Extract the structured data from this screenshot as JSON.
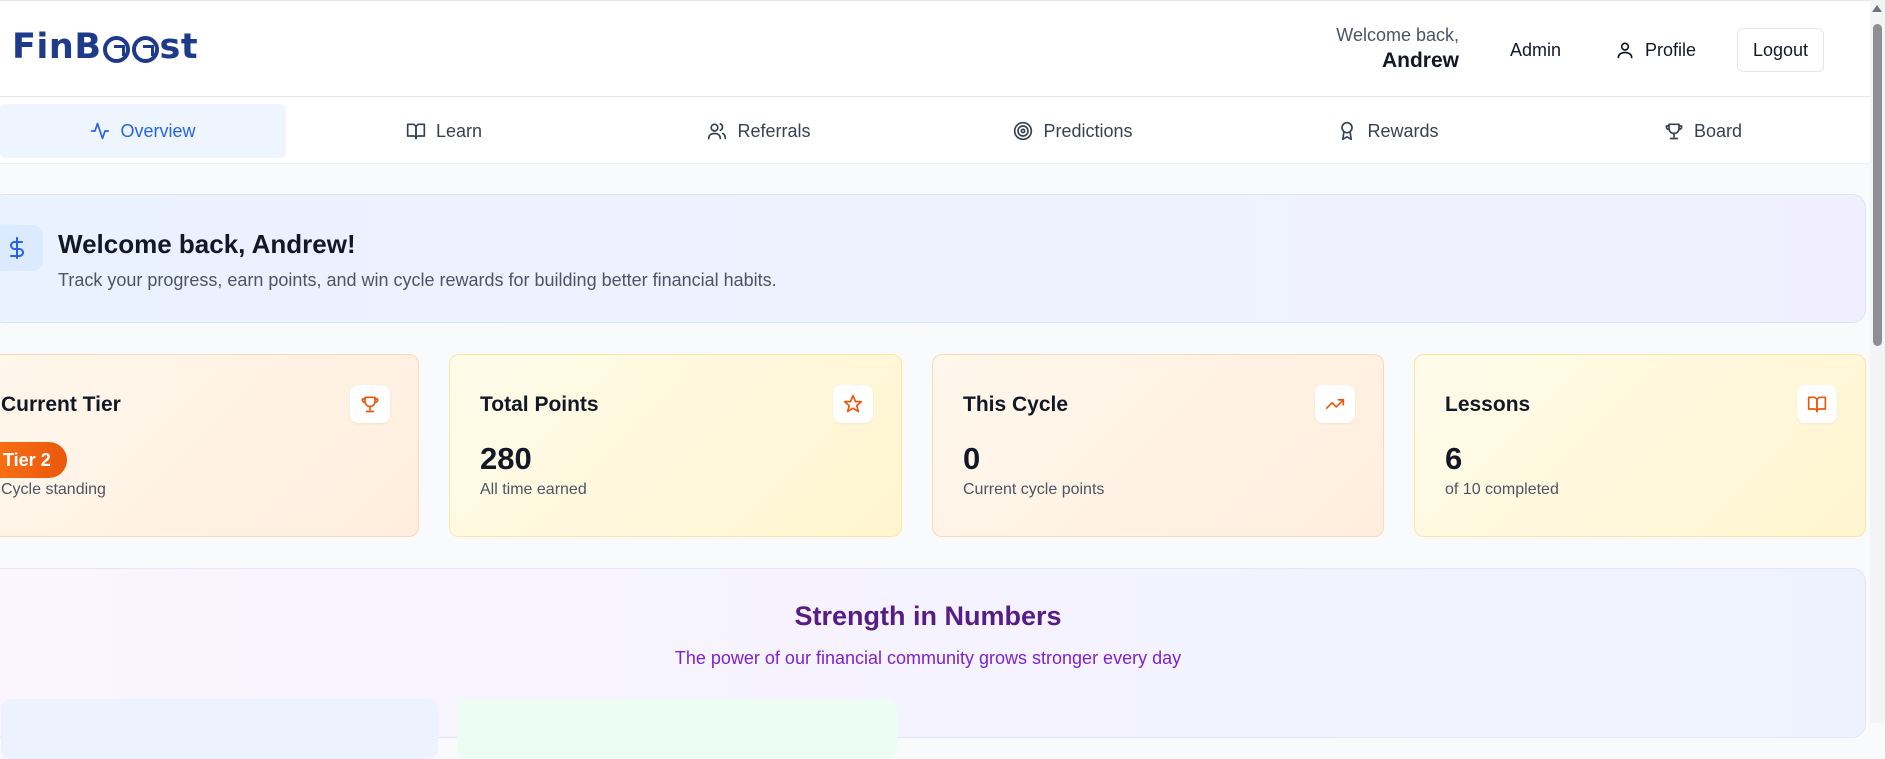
{
  "header": {
    "logo": "FinBoost",
    "welcome_prefix": "Welcome back,",
    "user_name": "Andrew",
    "admin_label": "Admin",
    "profile_label": "Profile",
    "logout_label": "Logout"
  },
  "tabs": [
    {
      "label": "Overview",
      "icon": "activity-icon",
      "active": true
    },
    {
      "label": "Learn",
      "icon": "book-open-icon",
      "active": false
    },
    {
      "label": "Referrals",
      "icon": "users-icon",
      "active": false
    },
    {
      "label": "Predictions",
      "icon": "target-icon",
      "active": false
    },
    {
      "label": "Rewards",
      "icon": "award-icon",
      "active": false
    },
    {
      "label": "Board",
      "icon": "trophy-icon",
      "active": false
    }
  ],
  "banner": {
    "icon": "dollar-icon",
    "title": "Welcome back, Andrew!",
    "subtitle": "Track your progress, earn points, and win cycle rewards for building better financial habits."
  },
  "stats": [
    {
      "title": "Current Tier",
      "badge": "Tier 2",
      "sub": "Cycle standing",
      "icon": "trophy-icon"
    },
    {
      "title": "Total Points",
      "value": "280",
      "sub": "All time earned",
      "icon": "star-icon"
    },
    {
      "title": "This Cycle",
      "value": "0",
      "sub": "Current cycle points",
      "icon": "trending-up-icon"
    },
    {
      "title": "Lessons",
      "value": "6",
      "sub": "of 10 completed",
      "icon": "book-open-icon"
    }
  ],
  "strength": {
    "title": "Strength in Numbers",
    "subtitle": "The power of our financial community grows stronger every day"
  },
  "colors": {
    "brand": "#1e3a8a",
    "accent": "#2563eb",
    "tier_badge": "#f97316",
    "icon_orange": "#ea580c",
    "strength_title": "#581c87"
  }
}
